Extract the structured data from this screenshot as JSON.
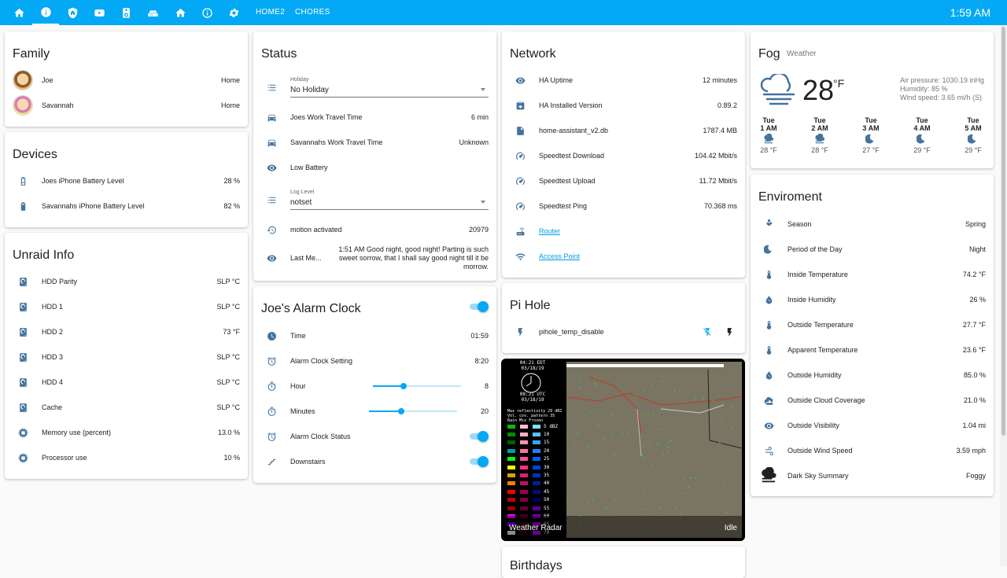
{
  "topbar": {
    "tabs": [
      "HOME2",
      "CHORES"
    ],
    "time": "1:59 AM",
    "icons": [
      "home-icon",
      "info-icon",
      "shield-home-icon",
      "youtube-icon",
      "speaker-icon",
      "router-icon",
      "home-outline-icon",
      "info-outline-icon",
      "gear-icon"
    ]
  },
  "family": {
    "title": "Family",
    "rows": [
      {
        "name": "Joe",
        "value": "Home"
      },
      {
        "name": "Savannah",
        "value": "Home"
      }
    ]
  },
  "devices": {
    "title": "Devices",
    "rows": [
      {
        "name": "Joes iPhone Battery Level",
        "value": "28 %"
      },
      {
        "name": "Savannahs iPhone Battery Level",
        "value": "82 %"
      }
    ]
  },
  "unraid": {
    "title": "Unraid Info",
    "rows": [
      {
        "name": "HDD Parity",
        "value": "SLP °C"
      },
      {
        "name": "HDD 1",
        "value": "SLP °C"
      },
      {
        "name": "HDD 2",
        "value": "73 °F"
      },
      {
        "name": "HDD 3",
        "value": "SLP °C"
      },
      {
        "name": "HDD 4",
        "value": "SLP °C"
      },
      {
        "name": "Cache",
        "value": "SLP °C"
      },
      {
        "name": "Memory use (percent)",
        "value": "13.0 %"
      },
      {
        "name": "Processor use",
        "value": "10 %"
      }
    ]
  },
  "status": {
    "title": "Status",
    "holiday_label": "Holiday",
    "holiday_value": "No Holiday",
    "joes_travel": {
      "name": "Joes Work Travel Time",
      "value": "6 min"
    },
    "savannahs_travel": {
      "name": "Savannahs Work Travel Time",
      "value": "Unknown"
    },
    "low_battery": "Low Battery",
    "log_label": "Log Level",
    "log_value": "notset",
    "motion": {
      "name": "motion activated",
      "value": "20979"
    },
    "last_message": {
      "name": "Last Me...",
      "value": "1:51 AM Good night, good night! Parting is such sweet sorrow, that I shall say good night till it be morrow."
    }
  },
  "alarm": {
    "title": "Joe's Alarm Clock",
    "time": {
      "name": "Time",
      "value": "01:59"
    },
    "setting": {
      "name": "Alarm Clock Setting",
      "value": "8:20"
    },
    "hour": {
      "name": "Hour",
      "value": "8",
      "level": 0.35
    },
    "minutes": {
      "name": "Minutes",
      "value": "20",
      "level": 0.37
    },
    "status": "Alarm Clock Status",
    "downstairs": "Downstairs"
  },
  "network": {
    "title": "Network",
    "rows": [
      {
        "name": "HA Uptime",
        "value": "12 minutes"
      },
      {
        "name": "HA Installed Version",
        "value": "0.89.2"
      },
      {
        "name": "home-assistant_v2.db",
        "value": "1787.4 MB"
      },
      {
        "name": "Speedtest Download",
        "value": "104.42 Mbit/s"
      },
      {
        "name": "Speedtest Upload",
        "value": "11.72 Mbit/s"
      },
      {
        "name": "Speedtest Ping",
        "value": "70.368 ms"
      }
    ],
    "router": "Router",
    "access_point": "Access Point"
  },
  "pihole": {
    "title": "Pi Hole",
    "entity": "pihole_temp_disable"
  },
  "radar": {
    "title": "Weather Radar",
    "state": "Idle",
    "time_edt": "04:21 EDT",
    "date1": "03/18/19",
    "time_utc": "08:21 UTC",
    "date2": "03/18/19",
    "legend_title": "Max reflectivity 29 dBZ",
    "vcp": "Vol. cov. pattern 35",
    "cols": [
      "Rain",
      "Mix",
      "Frozen"
    ],
    "dbz": [
      "5 dBZ",
      "10",
      "15",
      "20",
      "25",
      "30",
      "35",
      "40",
      "45",
      "50",
      "55",
      "60",
      "65",
      "70"
    ]
  },
  "birthdays": {
    "title": "Birthdays"
  },
  "weather": {
    "condition": "Fog",
    "label": "Weather",
    "temp": "28",
    "unit": "°F",
    "pressure": "Air pressure: 1030.19 inHg",
    "humidity": "Humidity: 85 %",
    "wind": "Wind speed: 3.65 mi/h (S)",
    "forecast": [
      {
        "day": "Tue",
        "hour": "1 AM",
        "temp": "28 °F"
      },
      {
        "day": "Tue",
        "hour": "2 AM",
        "temp": "28 °F"
      },
      {
        "day": "Tue",
        "hour": "3 AM",
        "temp": "27 °F"
      },
      {
        "day": "Tue",
        "hour": "4 AM",
        "temp": "29 °F"
      },
      {
        "day": "Tue",
        "hour": "5 AM",
        "temp": "29 °F"
      }
    ]
  },
  "environment": {
    "title": "Enviroment",
    "rows": [
      {
        "name": "Season",
        "value": "Spring"
      },
      {
        "name": "Period of the Day",
        "value": "Night"
      },
      {
        "name": "Inside Temperature",
        "value": "74.2 °F"
      },
      {
        "name": "Inside Humidity",
        "value": "26 %"
      },
      {
        "name": "Outside Temperature",
        "value": "27.7 °F"
      },
      {
        "name": "Apparent Temperature",
        "value": "23.6 °F"
      },
      {
        "name": "Outside Humidity",
        "value": "85.0 %"
      },
      {
        "name": "Outside Cloud Coverage",
        "value": "21.0 %"
      },
      {
        "name": "Outside Visibility",
        "value": "1.04 mi"
      },
      {
        "name": "Outside Wind Speed",
        "value": "3.59 mph"
      },
      {
        "name": "Dark Sky Summary",
        "value": "Foggy"
      }
    ]
  },
  "colors": {
    "accent": "#03a9f4",
    "icon": "#44739e"
  }
}
